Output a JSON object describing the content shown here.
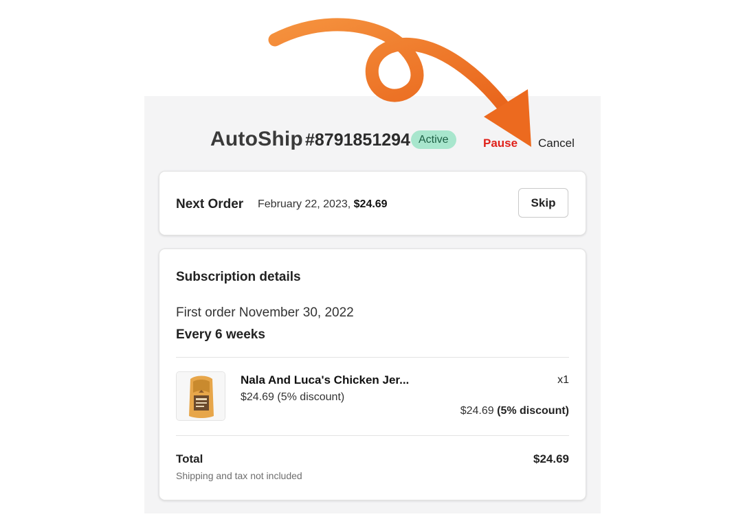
{
  "header": {
    "brand": "AutoShip",
    "order_id": "#8791851294",
    "status": "Active",
    "pause_label": "Pause",
    "cancel_label": "Cancel"
  },
  "next_order": {
    "label": "Next Order",
    "date": "February 22, 2023, ",
    "amount": "$24.69",
    "skip_label": "Skip"
  },
  "subscription": {
    "title": "Subscription details",
    "first_order": "First order November 30, 2022",
    "frequency": "Every 6 weeks",
    "items": [
      {
        "name": "Nala And Luca's Chicken Jer...",
        "price": "$24.69",
        "discount": "(5% discount)",
        "quantity": "x1",
        "line_total": "$24.69",
        "line_discount": "(5% discount)"
      }
    ],
    "total_label": "Total",
    "total_note": "Shipping and tax not included",
    "total_amount": "$24.69"
  },
  "colors": {
    "accent_arrow": "#f07a22",
    "pause": "#e0211a",
    "badge_bg": "#a8e6cd",
    "badge_text": "#1b5e43"
  },
  "icons": {
    "annotation": "curved-arrow-icon",
    "product": "product-thumbnail"
  }
}
